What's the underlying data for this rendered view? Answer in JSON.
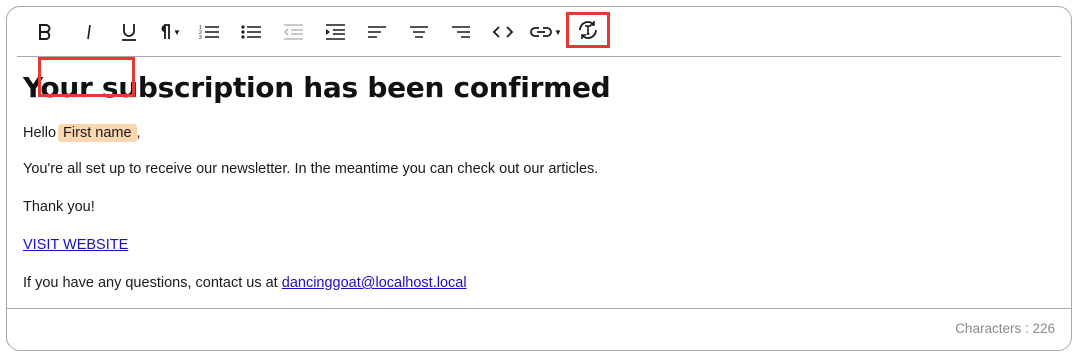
{
  "toolbar": {
    "buttons": [
      {
        "name": "bold-button",
        "icon": "bold-icon"
      },
      {
        "name": "italic-button",
        "icon": "italic-icon"
      },
      {
        "name": "underline-button",
        "icon": "underline-icon"
      },
      {
        "name": "paragraph-format-button",
        "icon": "paragraph-icon",
        "dropdown": true
      },
      {
        "name": "ordered-list-button",
        "icon": "ordered-list-icon"
      },
      {
        "name": "unordered-list-button",
        "icon": "unordered-list-icon"
      },
      {
        "name": "outdent-button",
        "icon": "outdent-icon",
        "disabled": true
      },
      {
        "name": "indent-button",
        "icon": "indent-icon"
      },
      {
        "name": "align-left-button",
        "icon": "align-left-icon"
      },
      {
        "name": "align-center-button",
        "icon": "align-center-icon"
      },
      {
        "name": "align-right-button",
        "icon": "align-right-icon"
      },
      {
        "name": "code-view-button",
        "icon": "code-icon"
      },
      {
        "name": "insert-link-button",
        "icon": "link-icon",
        "dropdown": true
      },
      {
        "name": "insert-dynamic-text-button",
        "icon": "dynamic-text-icon",
        "highlighted": true
      }
    ]
  },
  "content": {
    "heading": "Your subscription has been confirmed",
    "greeting_prefix": "Hello",
    "token_label": "First name",
    "greeting_suffix": ",",
    "paragraph_1": "You're all set up to receive our newsletter. In the meantime you can check out our articles.",
    "paragraph_2": "Thank you!",
    "visit_link": "VISIT WEBSITE",
    "contact_prefix": "If you have any questions, contact us at",
    "contact_email": "dancinggoat@localhost.local"
  },
  "footer": {
    "characters_label": "Characters : 226"
  },
  "colors": {
    "token_background": "#fbd7b0",
    "highlight_red": "#e53935",
    "link": "#1a0dcc"
  }
}
